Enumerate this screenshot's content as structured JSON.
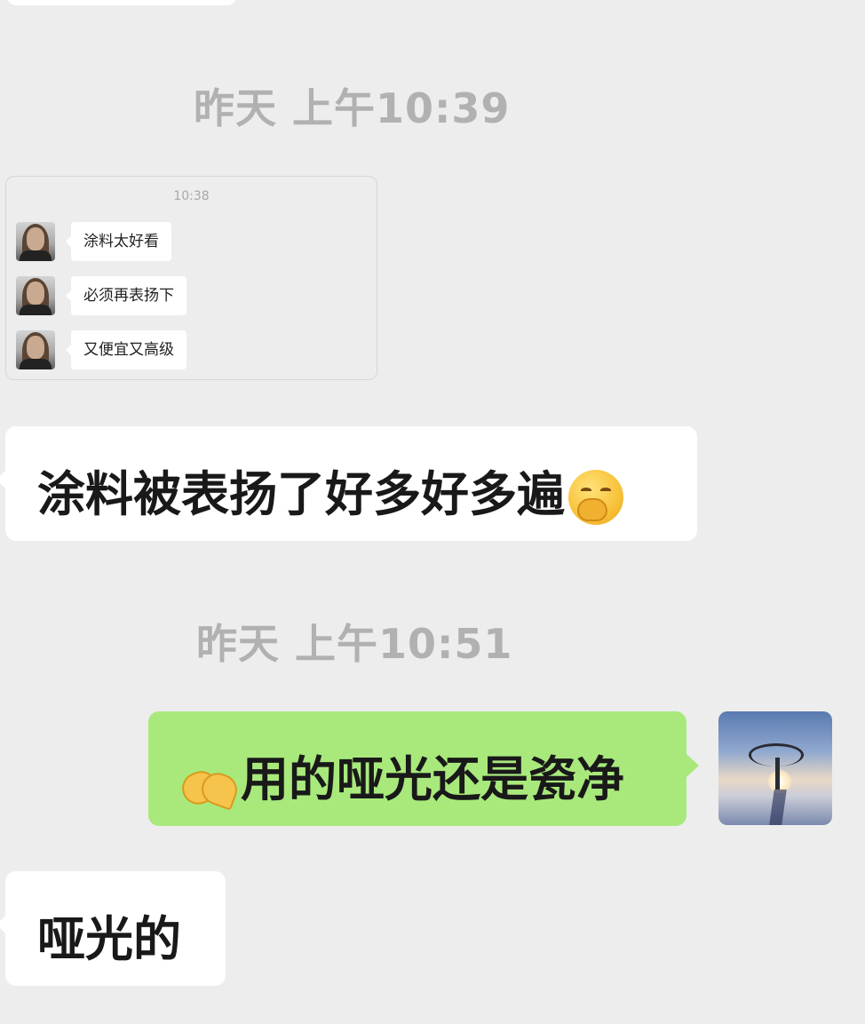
{
  "timestamps": [
    "昨天 上午10:39",
    "昨天 上午10:51"
  ],
  "forwarded_card": {
    "time": "10:38",
    "messages": [
      "涂料太好看",
      "必须再表扬下",
      "又便宜又高级"
    ]
  },
  "messages": [
    {
      "text": "涂料被表扬了好多好多遍",
      "emoji": "face-with-hand-over-mouth"
    },
    {
      "text": "用的哑光还是瓷净",
      "emoji": "pinched-hands"
    },
    {
      "text": "哑光的"
    }
  ],
  "colors": {
    "background": "#ededed",
    "received_bubble": "#ffffff",
    "sent_bubble": "#a9e97c",
    "timestamp_text": "#b1b1b1"
  }
}
